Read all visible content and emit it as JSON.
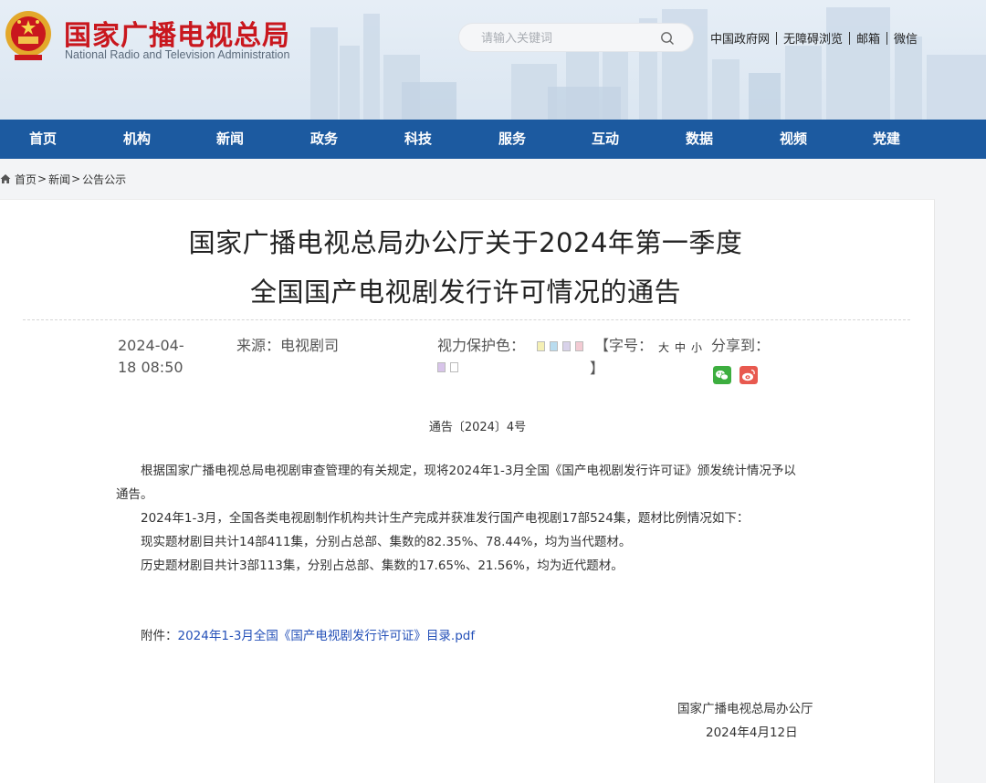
{
  "header": {
    "logo_cn": "国家广播电视总局",
    "logo_en": "National Radio and Television Administration",
    "search_placeholder": "请输入关键词",
    "top_links": [
      "中国政府网",
      "无障碍浏览",
      "邮箱",
      "微信"
    ]
  },
  "nav": [
    "首页",
    "机构",
    "新闻",
    "政务",
    "科技",
    "服务",
    "互动",
    "数据",
    "视频",
    "党建"
  ],
  "breadcrumb": {
    "items": [
      "首页",
      "新闻",
      "公告公示"
    ],
    "sep": ">"
  },
  "article": {
    "title_line1": "国家广播电视总局办公厅关于2024年第一季度",
    "title_line2": "全国国产电视剧发行许可情况的通告",
    "date_line1": "2024-04-",
    "date_line2": "18 08:50",
    "source": "来源：电视剧司",
    "eye_protect_label": "视力保护色：",
    "eye_colors": [
      "#f5f0b4",
      "#b9dcef",
      "#d8d2ea",
      "#f3cbd3",
      "#d8c4ea",
      "#ffffff"
    ],
    "font_label": "【字号：",
    "font_close": "】",
    "font_sizes": [
      "大",
      "中",
      "小"
    ],
    "share_label": "分享到：",
    "doc_number": "通告〔2024〕4号",
    "paragraphs": [
      "根据国家广播电视总局电视剧审查管理的有关规定，现将2024年1-3月全国《国产电视剧发行许可证》颁发统计情况予以",
      "通告。",
      "2024年1-3月，全国各类电视剧制作机构共计生产完成并获准发行国产电视剧17部524集，题材比例情况如下：",
      "现实题材剧目共计14部411集，分别占总部、集数的82.35%、78.44%，均为当代题材。",
      "历史题材剧目共计3部113集，分别占总部、集数的17.65%、21.56%，均为近代题材。"
    ],
    "attachment_label": "附件：",
    "attachment_link": "2024年1-3月全国《国产电视剧发行许可证》目录.pdf",
    "sign_org": "国家广播电视总局办公厅",
    "sign_date": "2024年4月12日"
  },
  "colors": {
    "nav_bg": "#1c5aa0",
    "logo_red": "#c9171e",
    "link_blue": "#2450b8",
    "wechat_green": "#3dae3f",
    "weibo_red": "#e8594f"
  }
}
